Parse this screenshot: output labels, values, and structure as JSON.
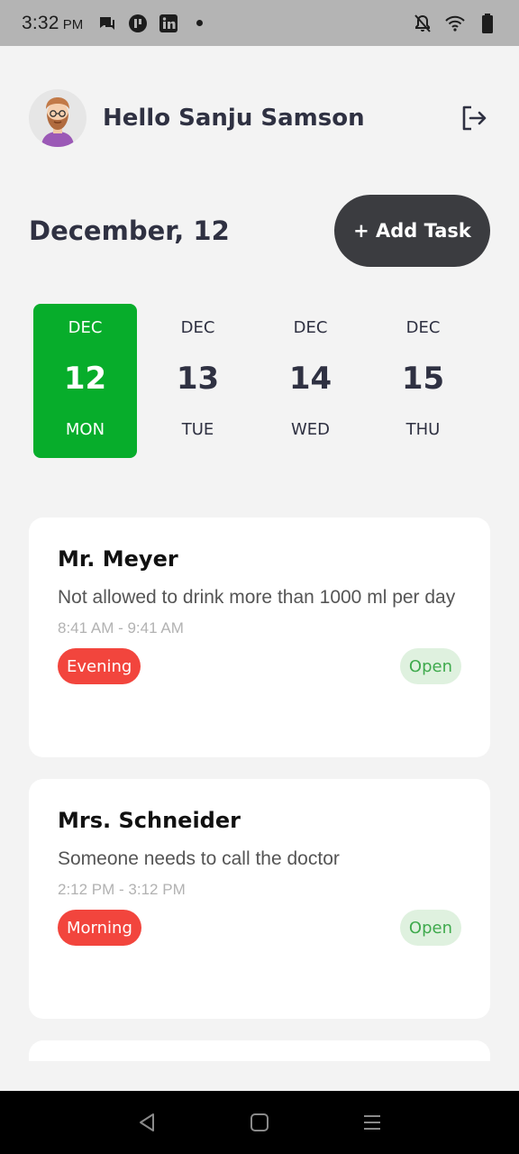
{
  "status_bar": {
    "time": "3:32",
    "ampm": "PM",
    "left_icons": [
      "message-icon",
      "app-icon",
      "linkedin-icon"
    ],
    "right_icons": [
      "notifications-off-icon",
      "wifi-icon",
      "battery-icon"
    ]
  },
  "header": {
    "greeting": "Hello Sanju Samson",
    "avatar_icon": "user-avatar",
    "logout_icon": "logout-icon"
  },
  "date_row": {
    "title": "December, 12",
    "add_task_label": "+ Add Task"
  },
  "days": [
    {
      "month": "DEC",
      "num": "12",
      "weekday": "MON",
      "selected": true
    },
    {
      "month": "DEC",
      "num": "13",
      "weekday": "TUE",
      "selected": false
    },
    {
      "month": "DEC",
      "num": "14",
      "weekday": "WED",
      "selected": false
    },
    {
      "month": "DEC",
      "num": "15",
      "weekday": "THU",
      "selected": false
    }
  ],
  "tasks": [
    {
      "name": "Mr. Meyer",
      "description": "Not allowed to drink more than 1000 ml per day",
      "time": "8:41 AM - 9:41 AM",
      "period": "Evening",
      "status": "Open"
    },
    {
      "name": "Mrs. Schneider",
      "description": "Someone needs to call the doctor",
      "time": "2:12 PM - 3:12 PM",
      "period": "Morning",
      "status": "Open"
    }
  ],
  "colors": {
    "accent_green": "#07ad2b",
    "button_dark": "#3b3c40",
    "tag_red": "#f2453d",
    "status_green_bg": "#dff1df",
    "status_green_text": "#3faa4d"
  },
  "nav": [
    "back-icon",
    "home-icon",
    "menu-icon"
  ]
}
